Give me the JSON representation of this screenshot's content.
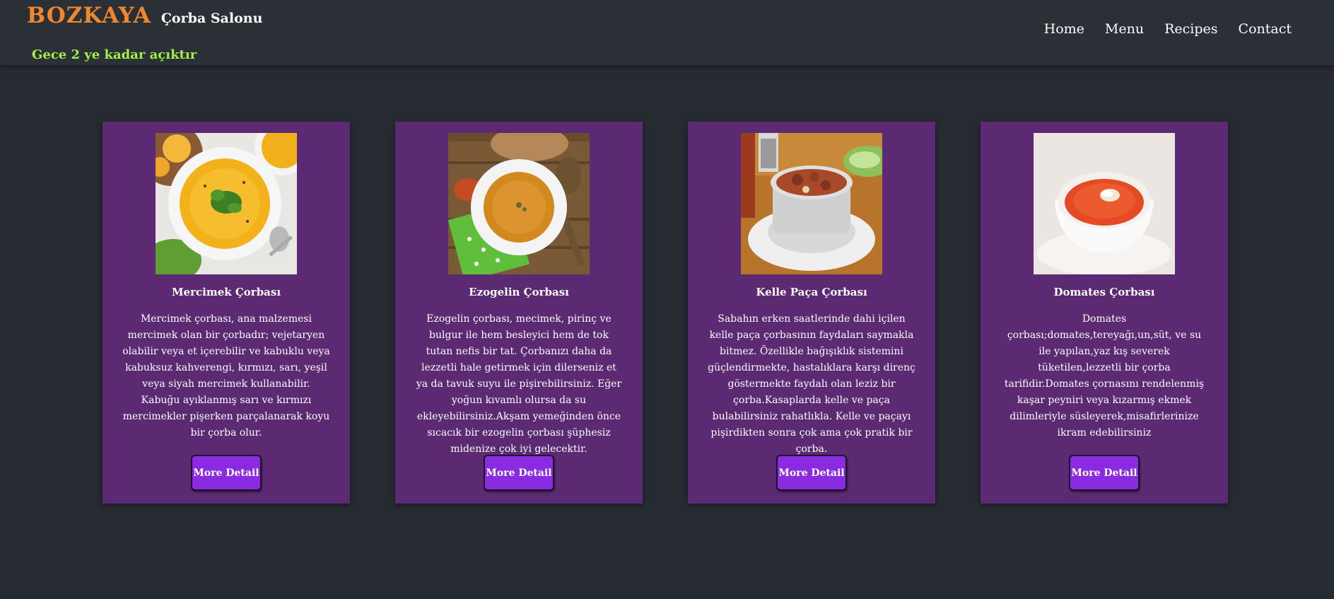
{
  "header": {
    "brand_name": "BOZKAYA",
    "brand_sub": "Çorba Salonu",
    "hours": "Gece 2 ye kadar açıktır",
    "nav": [
      "Home",
      "Menu",
      "Recipes",
      "Contact"
    ]
  },
  "cards": [
    {
      "title": "Mercimek Çorbası",
      "text": "Mercimek çorbası, ana malzemesi mercimek olan bir çorbadır; vejetaryen olabilir veya et içerebilir ve kabuklu veya kabuksuz kahverengi, kırmızı, sarı, yeşil veya siyah mercimek kullanabilir. Kabuğu ayıklanmış sarı ve kırmızı mercimekler pişerken parçalanarak koyu bir çorba olur.",
      "button": "More Detail"
    },
    {
      "title": "Ezogelin Çorbası",
      "text": "Ezogelin çorbası, mecimek, pirinç ve bulgur ile hem besleyici hem de tok tutan nefis bir tat. Çorbanızı daha da lezzetli hale getirmek için dilerseniz et ya da tavuk suyu ile pişirebilirsiniz. Eğer yoğun kıvamlı olursa da su ekleyebilirsiniz.Akşam yemeğinden önce sıcacık bir ezogelin çorbası şüphesiz midenize çok iyi gelecektir.",
      "button": "More Detail"
    },
    {
      "title": "Kelle Paça Çorbası",
      "text": "Sabahın erken saatlerinde dahi içilen kelle paça çorbasının faydaları saymakla bitmez. Özellikle bağışıklık sistemini güçlendirmekte, hastalıklara karşı direnç göstermekte faydalı olan leziz bir çorba.Kasaplarda kelle ve paça bulabilirsiniz rahatlıkla. Kelle ve paçayı pişirdikten sonra çok ama çok pratik bir çorba.",
      "button": "More Detail"
    },
    {
      "title": "Domates Çorbası",
      "text": "Domates çorbası;domates,tereyağı,un,süt, ve su ile yapılan,yaz kış severek tüketilen,lezzetli bir çorba tarifidir.Domates çornasını rendelenmiş kaşar peyniri veya kızarmış ekmek dilimleriyle süsleyerek,misafirlerinize ikram edebilirsiniz",
      "button": "More Detail"
    }
  ],
  "colors": {
    "background": "#262a31",
    "header": "#2b2f36",
    "brand": "#f0872d",
    "hours": "#a2f043",
    "card": "#5b2a72",
    "button": "#8a2be2"
  }
}
